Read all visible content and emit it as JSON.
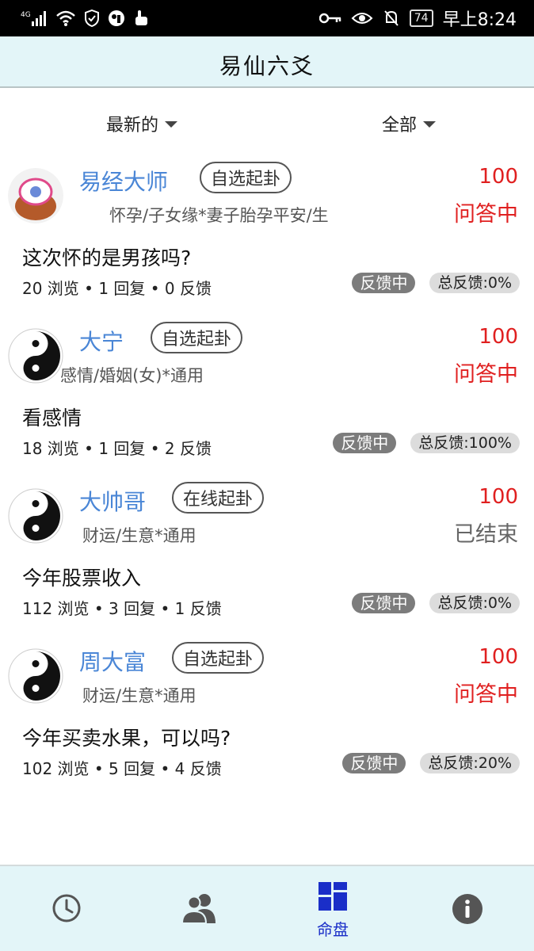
{
  "status_bar": {
    "network": "4G",
    "time": "早上8:24",
    "battery": "74"
  },
  "header": {
    "title": "易仙六爻"
  },
  "filters": {
    "sort": "最新的",
    "scope": "全部"
  },
  "posts": [
    {
      "user": "易经大师",
      "method": "自选起卦",
      "category": "怀孕/子女缘*妻子胎孕平安/生",
      "score": "100",
      "status": "问答中",
      "question": "这次怀的是男孩吗?",
      "stats": "20 浏览 • 1 回复 • 0 反馈",
      "feedback_status": "反馈中",
      "feedback_total": "总反馈:0%",
      "avatar": "decorated-avatar"
    },
    {
      "user": "大宁",
      "method": "自选起卦",
      "category": "感情/婚姻(女)*通用",
      "score": "100",
      "status": "问答中",
      "question": "看感情",
      "stats": "18 浏览 • 1 回复 • 2 反馈",
      "feedback_status": "反馈中",
      "feedback_total": "总反馈:100%",
      "avatar": "yin-yang-icon"
    },
    {
      "user": "大帅哥",
      "method": "在线起卦",
      "category": "财运/生意*通用",
      "score": "100",
      "status": "已结束",
      "question": "今年股票收入",
      "stats": "112 浏览 • 3 回复 • 1 反馈",
      "feedback_status": "反馈中",
      "feedback_total": "总反馈:0%",
      "avatar": "yin-yang-icon"
    },
    {
      "user": "周大富",
      "method": "自选起卦",
      "category": "财运/生意*通用",
      "score": "100",
      "status": "问答中",
      "question": "今年买卖水果，可以吗?",
      "stats": "102 浏览 • 5 回复 • 4 反馈",
      "feedback_status": "反馈中",
      "feedback_total": "总反馈:20%",
      "avatar": "yin-yang-icon"
    }
  ],
  "tabs": [
    {
      "icon": "clock-icon",
      "label": ""
    },
    {
      "icon": "users-icon",
      "label": ""
    },
    {
      "icon": "grid-icon",
      "label": "命盘",
      "active": true
    },
    {
      "icon": "info-icon",
      "label": ""
    }
  ],
  "colors": {
    "accent": "#1a2ec8",
    "username": "#4a86d6",
    "alert": "#e02020",
    "header_bg": "#e3f5f8"
  }
}
